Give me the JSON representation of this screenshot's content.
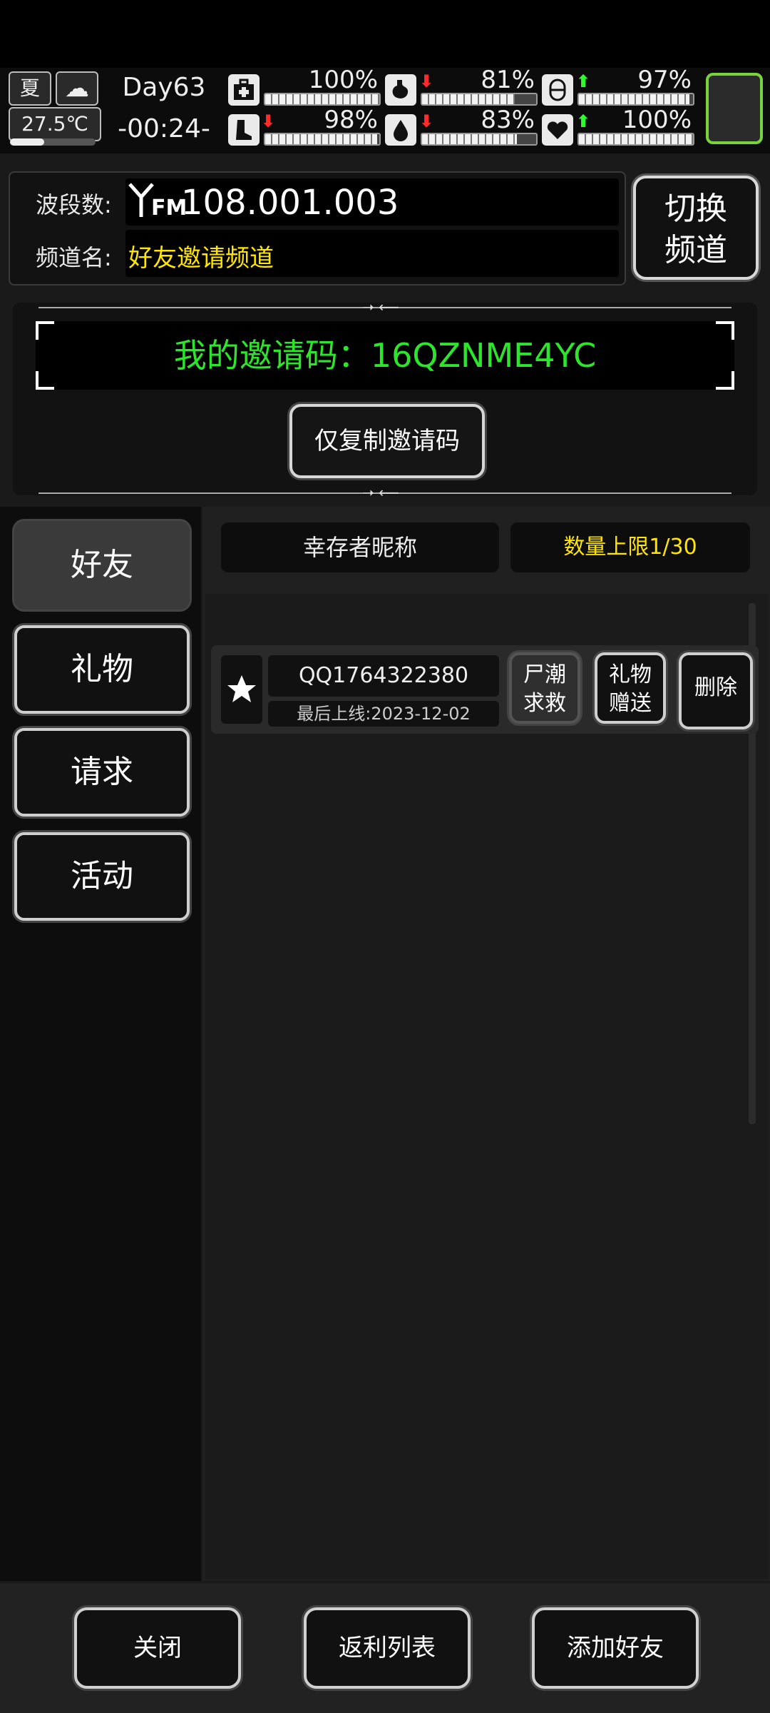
{
  "status": {
    "season": "夏",
    "temperature": "27.5℃",
    "day": "Day63",
    "time": "-00:24-",
    "stats": [
      {
        "name": "health",
        "icon": "medkit-icon",
        "value": "100%",
        "fill": 1.0,
        "trend": "none"
      },
      {
        "name": "hunger",
        "icon": "stomach-icon",
        "value": "81%",
        "fill": 0.81,
        "trend": "down"
      },
      {
        "name": "mood",
        "icon": "capsule-icon",
        "value": "97%",
        "fill": 0.97,
        "trend": "up"
      },
      {
        "name": "stamina",
        "icon": "boot-icon",
        "value": "98%",
        "fill": 0.98,
        "trend": "down"
      },
      {
        "name": "thirst",
        "icon": "water-drop-icon",
        "value": "83%",
        "fill": 0.83,
        "trend": "down"
      },
      {
        "name": "heart",
        "icon": "heart-icon",
        "value": "100%",
        "fill": 1.0,
        "trend": "up"
      }
    ],
    "colors": {
      "up": "#2dff2d",
      "down": "#ff2a2a",
      "active_frame": "#7bd33a"
    }
  },
  "channel": {
    "band_label": "波段数:",
    "band_prefix": "FM",
    "band_value": "108.001.003",
    "name_label": "频道名:",
    "name_value": "好友邀请频道",
    "switch_button": "切换\n频道"
  },
  "invite": {
    "code_text": "我的邀请码：16QZNME4YC",
    "copy_button": "仅复制邀请码"
  },
  "sidebar": {
    "items": [
      "好友",
      "礼物",
      "请求",
      "活动"
    ],
    "active_index": 0
  },
  "main": {
    "header_nickname": "幸存者昵称",
    "header_limit": "数量上限1/30",
    "friends": [
      {
        "name": "QQ1764322380",
        "last_online": "最后上线:2023-12-02",
        "actions": [
          "尸潮\n求救",
          "礼物\n赠送",
          "删除"
        ]
      }
    ]
  },
  "bottom": {
    "close": "关闭",
    "rebate_list": "返利列表",
    "add_friend": "添加好友"
  }
}
